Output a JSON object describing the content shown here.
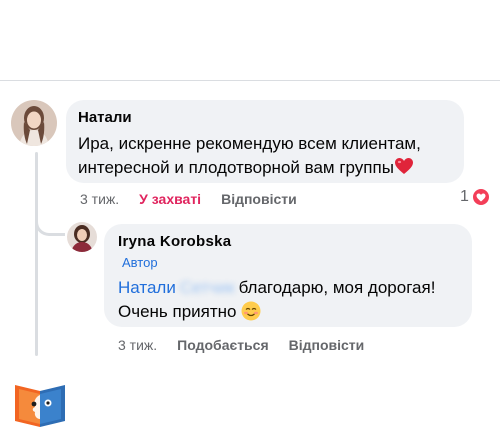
{
  "colors": {
    "bubble_bg": "#f0f2f5",
    "link_blue": "#216fdb",
    "meta_gray": "#65676b",
    "active_red": "#e0245e",
    "heart_red": "#f33e58"
  },
  "comment": {
    "author": "Натали",
    "text": "Ира, искренне рекомендую всем клиентам, интересной и плодотворной вам группы",
    "emoji": "❤️",
    "avatar_icon": "user-avatar",
    "time": "3 тиж.",
    "reaction_action": "У захваті",
    "reply_action": "Відповісти",
    "reaction_count": "1",
    "reaction_icon": "heart-reaction-icon"
  },
  "reply": {
    "author": "Iryna  Korobska",
    "badge": "Автор",
    "mention": "Натали",
    "mention_hidden": "Сетчик",
    "text_line1": "благодарю, моя дорогая!",
    "text_line2": "Очень приятно",
    "emoji_icon": "smiling-face-icon",
    "time": "3 тиж.",
    "like_action": "Подобається",
    "reply_action": "Відповісти"
  },
  "logo": {
    "icon": "book-face-logo-icon"
  }
}
